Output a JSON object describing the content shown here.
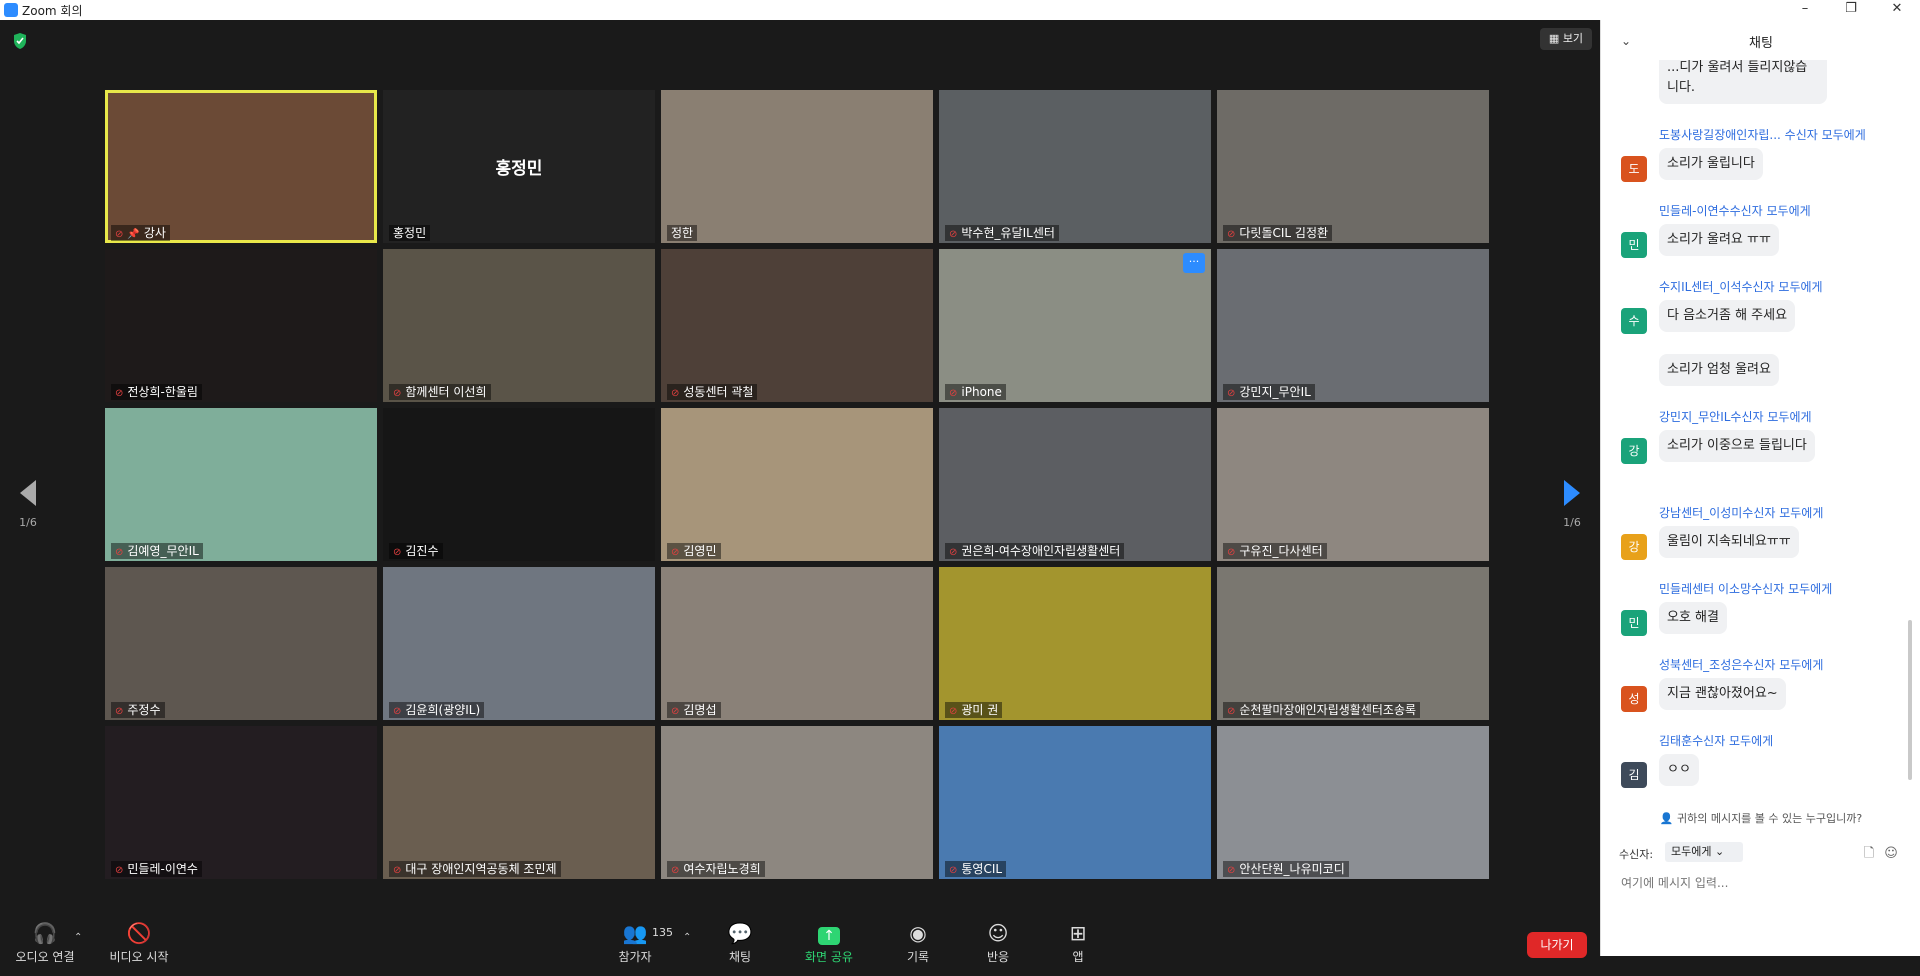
{
  "window": {
    "title": "Zoom 회의",
    "controls": [
      "–",
      "❐",
      "✕"
    ]
  },
  "view_button": {
    "label": "보기"
  },
  "nav": {
    "left_page": "1/6",
    "right_page": "1/6"
  },
  "participants": [
    {
      "name": "강사",
      "display": "",
      "bg": "#6b4a36",
      "active": true,
      "pinned": true,
      "muted": true
    },
    {
      "name": "홍정민",
      "display": "홍정민",
      "bg": "#222222",
      "active": false,
      "muted": false
    },
    {
      "name": "정한",
      "display": "",
      "bg": "#8a7f72",
      "active": false,
      "muted": false
    },
    {
      "name": "박수현_유달IL센터",
      "display": "",
      "bg": "#5b5f62",
      "active": false,
      "muted": true
    },
    {
      "name": "다릿돌CIL 김정환",
      "display": "",
      "bg": "#6e6b66",
      "active": false,
      "muted": true
    },
    {
      "name": "전상희-한울림",
      "display": "",
      "bg": "#1e1a1a",
      "active": false,
      "muted": true
    },
    {
      "name": "함께센터 이선희",
      "display": "",
      "bg": "#5a5448",
      "active": false,
      "muted": true
    },
    {
      "name": "성동센터 곽철",
      "display": "",
      "bg": "#4e4038",
      "active": false,
      "muted": true
    },
    {
      "name": "iPhone",
      "display": "",
      "bg": "#8b8e84",
      "active": false,
      "muted": true,
      "menu": true
    },
    {
      "name": "강민지_무안IL",
      "display": "",
      "bg": "#6a6d72",
      "active": false,
      "muted": true
    },
    {
      "name": "김예영_무안IL",
      "display": "",
      "bg": "#7fae9a",
      "active": false,
      "muted": true
    },
    {
      "name": "김진수",
      "display": "",
      "bg": "#161616",
      "active": false,
      "muted": true
    },
    {
      "name": "김영민",
      "display": "",
      "bg": "#a7957a",
      "active": false,
      "muted": true
    },
    {
      "name": "권은희-여수장애인자립생활센터",
      "display": "",
      "bg": "#5c5e62",
      "active": false,
      "muted": true
    },
    {
      "name": "구유진_다사센터",
      "display": "",
      "bg": "#8e8780",
      "active": false,
      "muted": true
    },
    {
      "name": "주정수",
      "display": "",
      "bg": "#5e5750",
      "active": false,
      "muted": true
    },
    {
      "name": "김윤희(광양IL)",
      "display": "",
      "bg": "#6f7680",
      "active": false,
      "muted": true
    },
    {
      "name": "김명섭",
      "display": "",
      "bg": "#8a8178",
      "active": false,
      "muted": true
    },
    {
      "name": "광미 권",
      "display": "",
      "bg": "#a3952e",
      "active": false,
      "muted": true
    },
    {
      "name": "순천팔마장애인자립생활센터조송록",
      "display": "",
      "bg": "#7a7770",
      "active": false,
      "muted": true
    },
    {
      "name": "민들레-이연수",
      "display": "",
      "bg": "#231d21",
      "active": false,
      "muted": true
    },
    {
      "name": "대구 장애인지역공동체 조민제",
      "display": "",
      "bg": "#6a5e50",
      "active": false,
      "muted": true
    },
    {
      "name": "여수자립노경희",
      "display": "",
      "bg": "#8d8780",
      "active": false,
      "muted": true
    },
    {
      "name": "통영CIL",
      "display": "",
      "bg": "#4a7ab0",
      "active": false,
      "muted": true
    },
    {
      "name": "안산단원_나유미코디",
      "display": "",
      "bg": "#8c8f94",
      "active": false,
      "muted": true
    }
  ],
  "toolbar": {
    "audio": "오디오 연결",
    "video": "비디오 시작",
    "participants": "참가자",
    "participants_count": "135",
    "chat": "채팅",
    "share": "화면 공유",
    "record": "기록",
    "reactions": "반응",
    "apps": "앱",
    "leave": "나가기"
  },
  "chat": {
    "header": "채팅",
    "messages": [
      {
        "sender": "",
        "avatar": "",
        "color": "",
        "text": "...디가 울려서 들리지않습니다."
      },
      {
        "sender": "도봉사랑길장애인자립... 수신자 모두에게",
        "avatar": "도",
        "color": "#d9531e",
        "text": "소리가 울립니다"
      },
      {
        "sender": "민들레-이연수수신자 모두에게",
        "avatar": "민",
        "color": "#1aa37a",
        "text": "소리가 울려요 ㅠㅠ"
      },
      {
        "sender": "수지IL센터_이석수신자 모두에게",
        "avatar": "수",
        "color": "#1aa37a",
        "text": "다 음소거좀 해 주세요"
      },
      {
        "sender": "",
        "avatar": "",
        "color": "",
        "text": "소리가 엄청 울려요"
      },
      {
        "sender": "강민지_무안IL수신자 모두에게",
        "avatar": "강",
        "color": "#1aa37a",
        "text": "소리가 이중으로 들립니다"
      },
      {
        "sender": "강남센터_이성미수신자 모두에게",
        "avatar": "강",
        "color": "#e8a11a",
        "text": "울림이 지속되네요ㅠㅠ"
      },
      {
        "sender": "민들레센터 이소망수신자 모두에게",
        "avatar": "민",
        "color": "#1aa37a",
        "text": "오호 해결"
      },
      {
        "sender": "성북센터_조성은수신자 모두에게",
        "avatar": "성",
        "color": "#d9531e",
        "text": "지금 괜찮아졌어요~"
      },
      {
        "sender": "김태훈수신자 모두에게",
        "avatar": "김",
        "color": "#3e4a5a",
        "text": "ㅇㅇ"
      }
    ],
    "who_can_see": "귀하의 메시지를 볼 수 있는 누구입니까?",
    "recipient_label": "수신자:",
    "recipient_value": "모두에게",
    "input_placeholder": "여기에 메시지 입력..."
  }
}
